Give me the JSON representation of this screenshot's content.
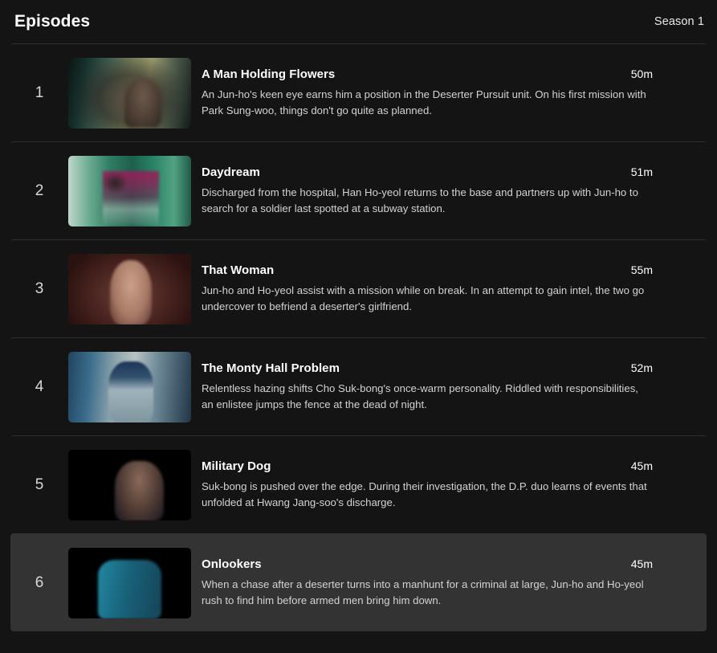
{
  "header": {
    "title": "Episodes",
    "season_label": "Season 1"
  },
  "colors": {
    "background": "#141414",
    "row_highlight": "#333333",
    "divider": "#2f2f2f",
    "title_text": "#ffffff",
    "synopsis_text": "#d2d2d2",
    "number_text": "#d8d8d8"
  },
  "episodes": [
    {
      "number": "1",
      "title": "A Man Holding Flowers",
      "duration": "50m",
      "synopsis": "An Jun-ho's keen eye earns him a position in the Deserter Pursuit unit. On his first mission with Park Sung-woo, things don't go quite as planned.",
      "thumbnail": "episode-1-thumbnail",
      "highlighted": false
    },
    {
      "number": "2",
      "title": "Daydream",
      "duration": "51m",
      "synopsis": "Discharged from the hospital, Han Ho-yeol returns to the base and partners up with Jun-ho to search for a soldier last spotted at a subway station.",
      "thumbnail": "episode-2-thumbnail",
      "highlighted": false
    },
    {
      "number": "3",
      "title": "That Woman",
      "duration": "55m",
      "synopsis": "Jun-ho and Ho-yeol assist with a mission while on break. In an attempt to gain intel, the two go undercover to befriend a deserter's girlfriend.",
      "thumbnail": "episode-3-thumbnail",
      "highlighted": false
    },
    {
      "number": "4",
      "title": "The Monty Hall Problem",
      "duration": "52m",
      "synopsis": "Relentless hazing shifts Cho Suk-bong's once-warm personality. Riddled with responsibilities, an enlistee jumps the fence at the dead of night.",
      "thumbnail": "episode-4-thumbnail",
      "highlighted": false
    },
    {
      "number": "5",
      "title": "Military Dog",
      "duration": "45m",
      "synopsis": "Suk-bong is pushed over the edge. During their investigation, the D.P. duo learns of events that unfolded at Hwang Jang-soo's discharge.",
      "thumbnail": "episode-5-thumbnail",
      "highlighted": false
    },
    {
      "number": "6",
      "title": "Onlookers",
      "duration": "45m",
      "synopsis": "When a chase after a deserter turns into a manhunt for a criminal at large, Jun-ho and Ho-yeol rush to find him before armed men bring him down.",
      "thumbnail": "episode-6-thumbnail",
      "highlighted": true
    }
  ]
}
